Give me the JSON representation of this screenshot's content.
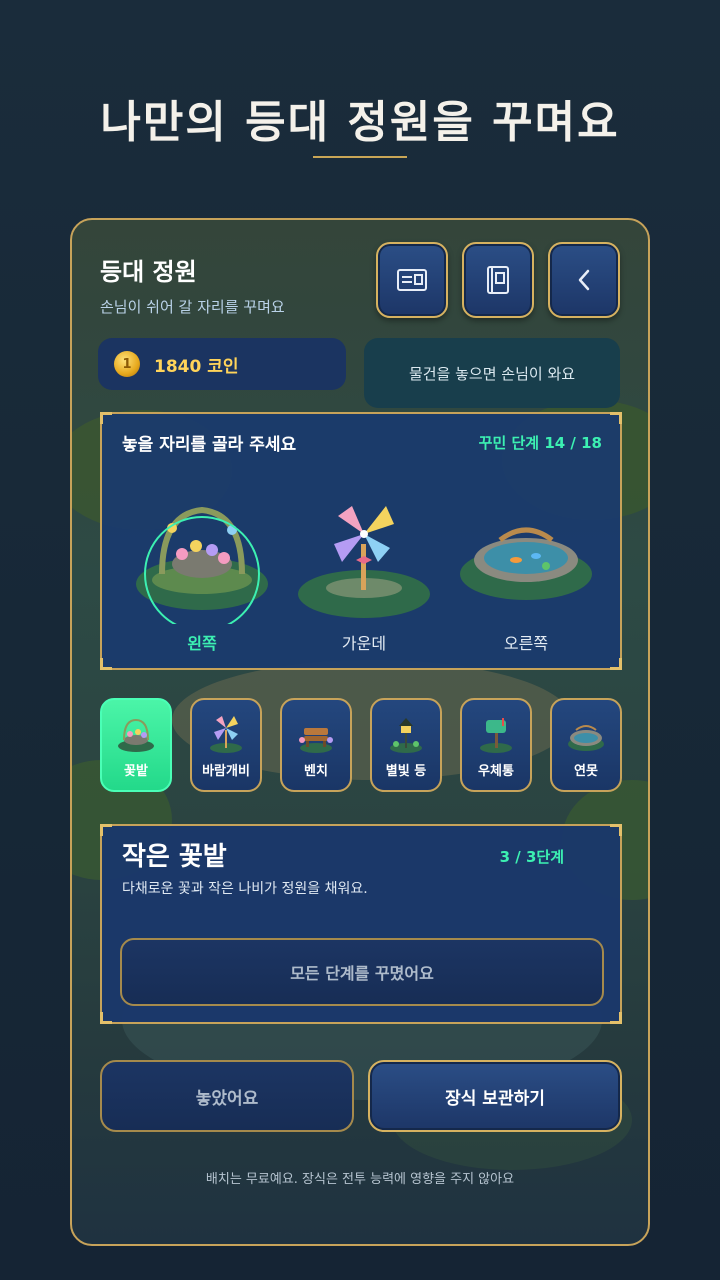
{
  "headline": "나만의 등대 정원을 꾸며요",
  "panel": {
    "title": "등대 정원",
    "subtitle": "손님이 쉬어 갈 자리를 꾸며요",
    "header_buttons": [
      {
        "icon": "card-icon"
      },
      {
        "icon": "book-icon"
      },
      {
        "icon": "back-chevron-icon"
      }
    ],
    "coins": "1840 코인",
    "notice": "물건을 놓으면 손님이 와요",
    "placement": {
      "title": "놓을 자리를 골라 주세요",
      "stage": "꾸민 단계 14 / 18",
      "slots": [
        {
          "label": "왼쪽",
          "selected": true
        },
        {
          "label": "가운데",
          "selected": false
        },
        {
          "label": "오른쪽",
          "selected": false
        }
      ]
    },
    "tabs": [
      {
        "label": "꽃밭",
        "active": true
      },
      {
        "label": "바람개비",
        "active": false
      },
      {
        "label": "벤치",
        "active": false
      },
      {
        "label": "별빛 등",
        "active": false
      },
      {
        "label": "우체통",
        "active": false
      },
      {
        "label": "연못",
        "active": false
      }
    ],
    "detail": {
      "name": "작은 꽃밭",
      "stage": "3 / 3단계",
      "description": "다채로운 꽃과 작은 나비가 정원을 채워요.",
      "button": "모든 단계를 꾸몄어요"
    },
    "actions": {
      "placed": "놓았어요",
      "store": "장식 보관하기"
    },
    "footer": "배치는 무료예요. 장식은 전투 능력에 영향을 주지 않아요"
  },
  "colors": {
    "gold": "#c7a35a",
    "mint": "#3cf0b2",
    "navy": "#1a3a6e",
    "coin": "#ffd45a"
  }
}
